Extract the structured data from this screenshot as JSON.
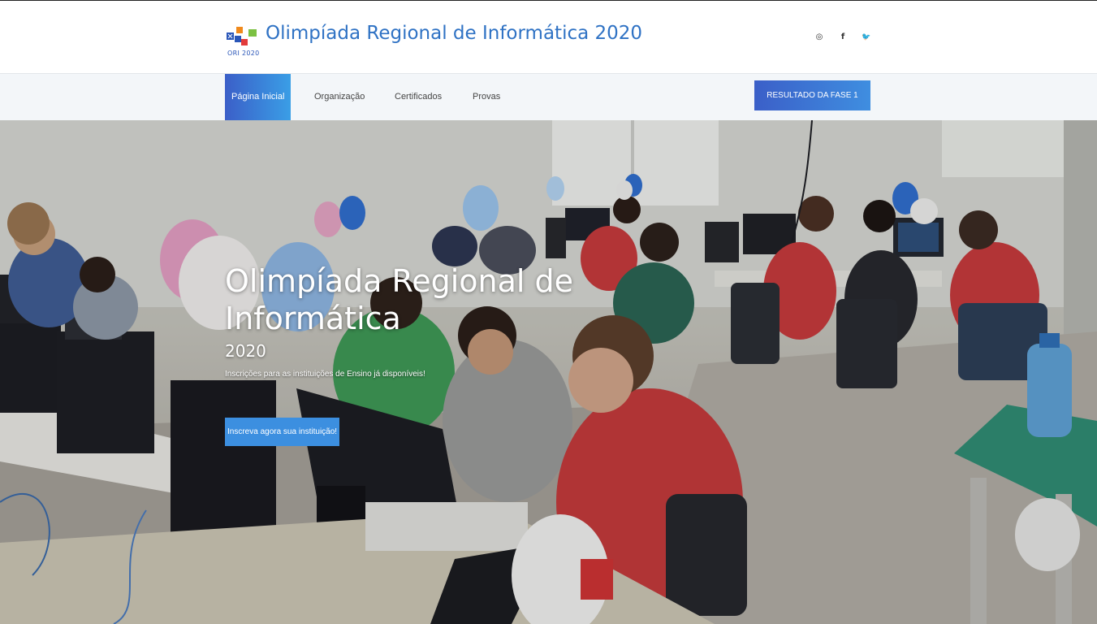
{
  "header": {
    "logo_caption": "ORI 2020",
    "site_title": "Olimpíada Regional de Informática 2020",
    "social": [
      {
        "icon": "instagram-icon",
        "glyph": "◎"
      },
      {
        "icon": "facebook-icon",
        "glyph": "f"
      },
      {
        "icon": "twitter-icon",
        "glyph": "🐦"
      }
    ]
  },
  "nav": {
    "items": [
      {
        "label": "Página Inicial",
        "active": true
      },
      {
        "label": "Organização",
        "active": false
      },
      {
        "label": "Certificados",
        "active": false
      },
      {
        "label": "Provas",
        "active": false
      }
    ],
    "cta_label": "RESULTADO DA FASE 1"
  },
  "hero": {
    "title": "Olimpíada Regional de Informática",
    "year": "2020",
    "subtitle": "Inscrições para as instituições de Ensino já disponíveis!",
    "cta_label": "Inscreva agora sua instituição!"
  },
  "colors": {
    "accent_blue": "#3b5fc8",
    "accent_light": "#3a9ee6",
    "title_blue": "#2f72c4",
    "nav_bg": "#f3f6f9"
  }
}
